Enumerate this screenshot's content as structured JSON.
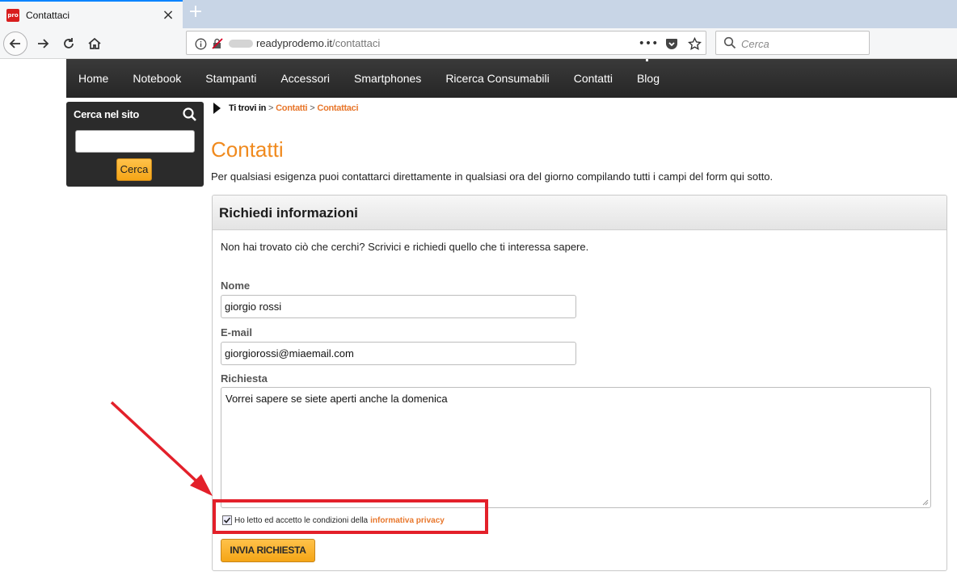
{
  "browser": {
    "tab_title": "Contattaci",
    "favicon_text": "pro",
    "url_domain": "readyprodemo.it",
    "url_path": "/contattaci",
    "search_placeholder": "Cerca"
  },
  "site": {
    "nav": [
      "Home",
      "Notebook",
      "Stampanti",
      "Accessori",
      "Smartphones",
      "Ricerca Consumabili",
      "Contatti",
      "Blog"
    ],
    "sidebar": {
      "title": "Cerca nel sito",
      "button": "Cerca",
      "input_value": ""
    },
    "breadcrumb": {
      "prefix": "Ti trovi in",
      "sep": ">",
      "items": [
        "Contatti",
        "Contattaci"
      ]
    },
    "page_title": "Contatti",
    "intro": "Per qualsiasi esigenza puoi contattarci direttamente in qualsiasi ora del giorno compilando tutti i campi del form qui sotto.",
    "form": {
      "title": "Richiedi informazioni",
      "description": "Non hai trovato ciò che cerchi? Scrivici e richiedi quello che ti interessa sapere.",
      "name_label": "Nome",
      "name_value": "giorgio rossi",
      "email_label": "E-mail",
      "email_value": "giorgiorossi@miaemail.com",
      "request_label": "Richiesta",
      "request_value": "Vorrei sapere se siete aperti anche la domenica",
      "privacy_text": "Ho letto ed accetto le condizioni della",
      "privacy_link": "informativa privacy",
      "privacy_checked": true,
      "submit": "INVIA RICHIESTA"
    }
  },
  "colors": {
    "accent_orange": "#f08a1e",
    "annotation_red": "#e3202a",
    "nav_dark": "#2b2b2b"
  }
}
